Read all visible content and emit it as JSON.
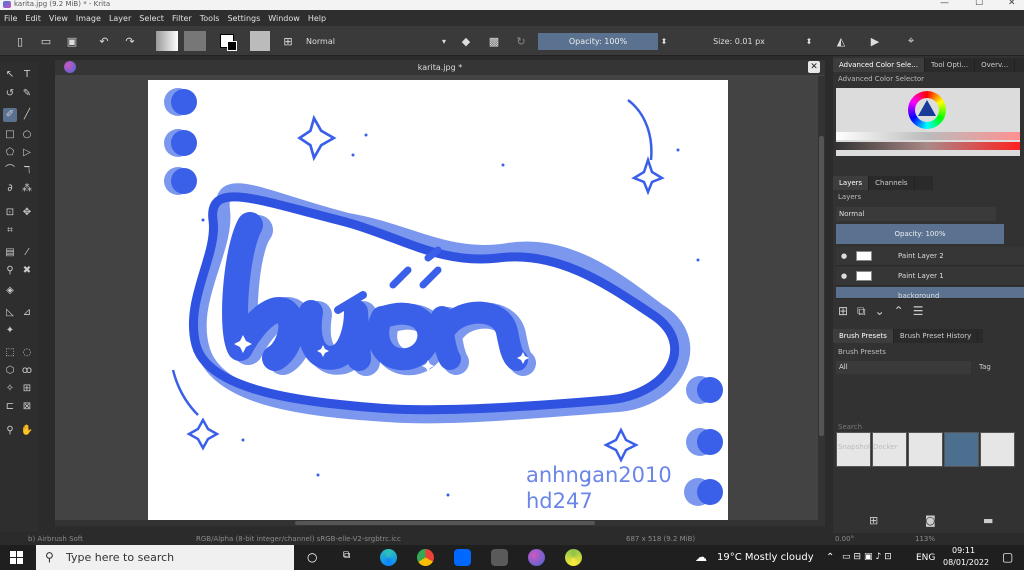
{
  "window": {
    "title": "karita.jpg (9.2 MiB)  * - Krita",
    "controls": [
      "—",
      "☐",
      "✕"
    ]
  },
  "menu": [
    "File",
    "Edit",
    "View",
    "Image",
    "Layer",
    "Select",
    "Filter",
    "Tools",
    "Settings",
    "Window",
    "Help"
  ],
  "toolbar": {
    "blend_mode": "Normal",
    "opacity": "Opacity: 100%",
    "size": "Size: 0.01 px"
  },
  "document": {
    "tab_title": "karita.jpg *",
    "close": "✕"
  },
  "artwork": {
    "word": "buồn",
    "watermark_line1": "anhngan2010",
    "watermark_line2": "hd247",
    "colors": {
      "main": "#3a5fe8",
      "light": "#7b97ee",
      "outline": "#2f52e0"
    }
  },
  "right_panel": {
    "top_tabs": [
      "Advanced Color Sele...",
      "Tool Opti...",
      "Overv..."
    ],
    "color_selector_label": "Advanced Color Selector",
    "layer_tabs": [
      "Layers",
      "Channels"
    ],
    "layers_label": "Layers",
    "layer_blend": "Normal",
    "layer_opacity": "Opacity:  100%",
    "layers": [
      "Paint Layer 2",
      "Paint Layer 1",
      "background"
    ],
    "preset_tabs": [
      "Brush Presets",
      "Brush Preset History"
    ],
    "presets_label": "Brush Presets",
    "preset_filter": "All",
    "tag_label": "Tag",
    "search_placeholder": "Search",
    "snapshot_label": "Snapshot Docker"
  },
  "status": {
    "brush": "b) Airbrush Soft",
    "color_space": "RGB/Alpha (8-bit integer/channel)  sRGB-elle-V2-srgbtrc.icc",
    "dimensions": "687 x 518 (9.2 MiB)",
    "rotation": "0.00°",
    "zoom": "113%"
  },
  "taskbar": {
    "search_placeholder": "Type here to search",
    "weather": "19°C  Mostly cloudy",
    "lang": "ENG",
    "time": "09:11",
    "date": "08/01/2022"
  }
}
